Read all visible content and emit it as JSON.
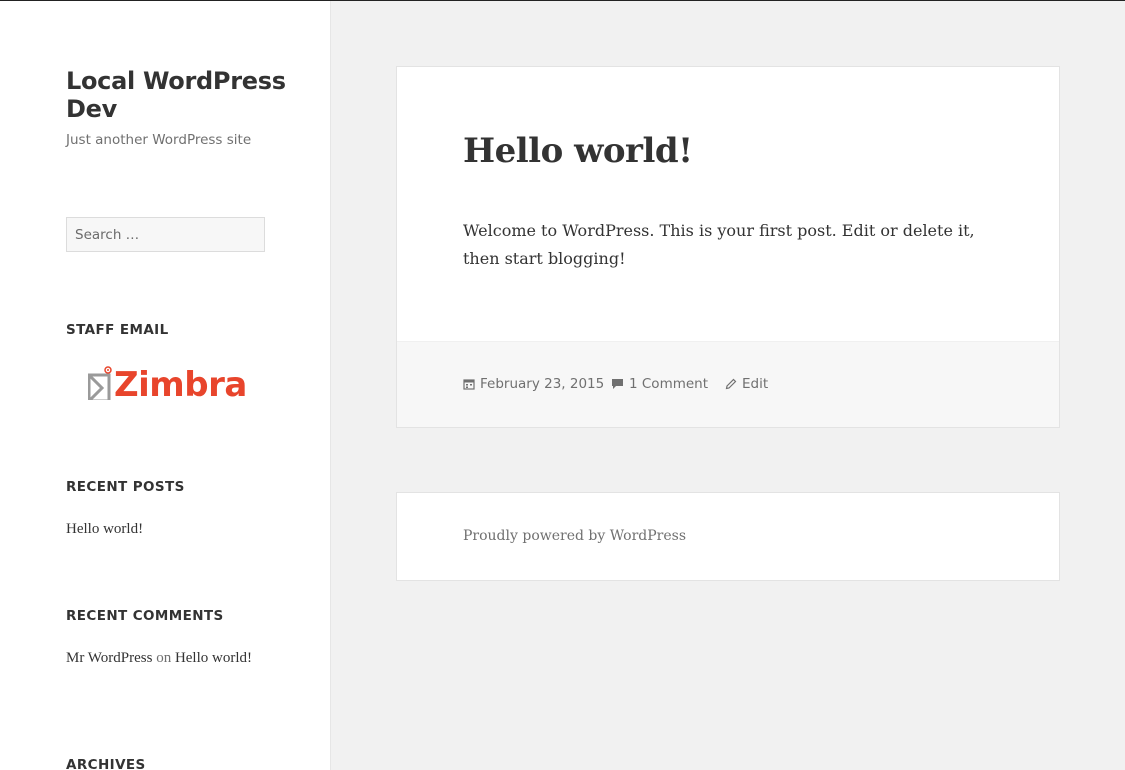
{
  "site": {
    "title": "Local WordPress Dev",
    "description": "Just another WordPress site"
  },
  "search": {
    "placeholder": "Search …"
  },
  "widgets": {
    "staff_email": {
      "title": "STAFF EMAIL",
      "logo_text": "Zimbra"
    },
    "recent_posts": {
      "title": "RECENT POSTS",
      "items": [
        "Hello world!"
      ]
    },
    "recent_comments": {
      "title": "RECENT COMMENTS",
      "author": "Mr WordPress",
      "on": "on",
      "post": "Hello world!"
    },
    "archives": {
      "title": "ARCHIVES"
    }
  },
  "post": {
    "title": "Hello world!",
    "body": "Welcome to WordPress. This is your first post. Edit or delete it, then start blogging!",
    "date": "February 23, 2015",
    "comments": "1 Comment",
    "edit": "Edit"
  },
  "footer": {
    "powered_by": "Proudly powered by WordPress"
  },
  "colors": {
    "accent": "#e8452c",
    "background": "#f1f1f1",
    "muted": "#707070"
  },
  "icons": [
    "calendar-icon",
    "comment-icon",
    "pencil-icon",
    "zimbra-envelope-icon"
  ]
}
